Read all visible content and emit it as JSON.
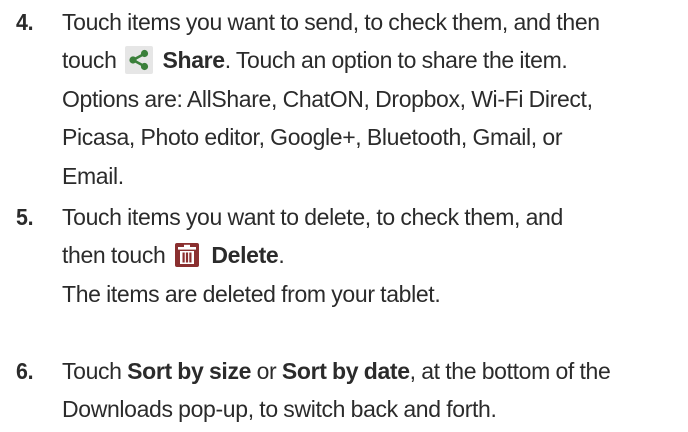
{
  "steps": [
    {
      "number": "4.",
      "line1": "Touch items you want to send, to check them, and then",
      "line2_pre": "touch",
      "line2_icon": "share-icon",
      "line2_bold": "Share",
      "line2_post": ". Touch an option to share the item.",
      "line3": "Options are: AllShare, ChatON, Dropbox, Wi-Fi Direct,",
      "line4": "Picasa, Photo editor, Google+, Bluetooth, Gmail, or",
      "line5": "Email."
    },
    {
      "number": "5.",
      "line1": "Touch items you want to delete, to check them, and",
      "line2_pre": "then touch",
      "line2_icon": "trash-icon",
      "line2_bold": "Delete",
      "line2_post": ".",
      "line3": "The items are deleted from your tablet."
    },
    {
      "number": "6.",
      "line1_pre": "Touch ",
      "line1_bold1": "Sort by size",
      "line1_mid": " or ",
      "line1_bold2": "Sort by date",
      "line1_post": ", at the bottom of the",
      "line2": "Downloads pop-up, to switch back and forth."
    }
  ],
  "colors": {
    "text": "#2b2b2b",
    "share_icon": "#3a7f3a",
    "trash_icon": "#8a2f2f",
    "icon_bg": "#e6e6e6"
  }
}
